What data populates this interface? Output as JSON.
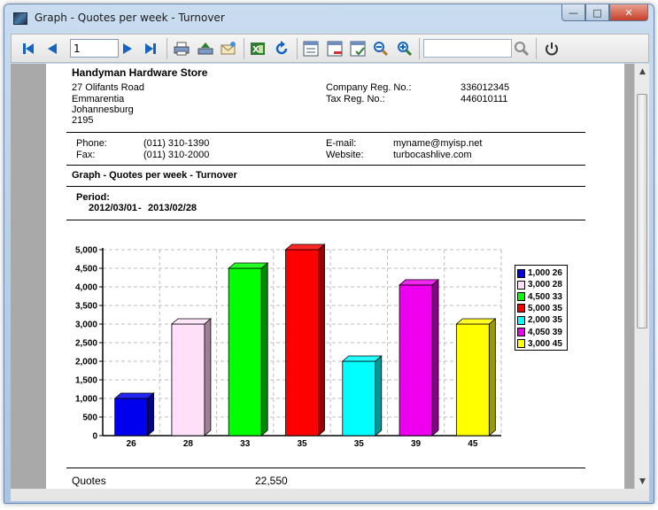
{
  "window": {
    "title": "Graph - Quotes per week - Turnover",
    "controls": {
      "minimize": "—",
      "maximize": "□",
      "close": "✕"
    }
  },
  "toolbar": {
    "page_number": "1",
    "search_value": "",
    "icons": [
      "first-page-icon",
      "previous-page-icon",
      "next-page-icon",
      "last-page-icon",
      "print-icon",
      "export-icon",
      "email-icon",
      "excel-icon",
      "refresh-icon",
      "layout-icon",
      "layout-remove-icon",
      "layout-check-icon",
      "zoom-out-icon",
      "zoom-in-icon",
      "search-icon",
      "power-icon"
    ]
  },
  "report": {
    "company": {
      "name": "Handyman Hardware Store",
      "address": [
        "27 Olifants Road",
        "Emmarentia",
        "Johannesburg",
        "2195"
      ],
      "company_reg_label": "Company Reg. No.:",
      "company_reg_value": "336012345",
      "tax_reg_label": "Tax Reg. No.:",
      "tax_reg_value": "446010111"
    },
    "contact": {
      "phone_label": "Phone:",
      "phone_value": "(011) 310-1390",
      "fax_label": "Fax:",
      "fax_value": "(011) 310-2000",
      "email_label": "E-mail:",
      "email_value": "myname@myisp.net",
      "website_label": "Website:",
      "website_value": "turbocashlive.com"
    },
    "report_title": "Graph - Quotes per week - Turnover",
    "period_label": "Period:",
    "period_from": "2012/03/01",
    "period_sep": "-",
    "period_to": "2013/02/28",
    "footer_label": "Quotes",
    "footer_total": "22,550"
  },
  "chart_data": {
    "type": "bar",
    "categories": [
      "26",
      "28",
      "33",
      "35",
      "35",
      "39",
      "45"
    ],
    "values": [
      1000,
      3000,
      4500,
      5000,
      2000,
      4050,
      3000
    ],
    "colors": [
      "#0000ee",
      "#ffe0f8",
      "#00ff00",
      "#ff0000",
      "#00ffff",
      "#ee00ee",
      "#ffff00"
    ],
    "side_colors": [
      "#000088",
      "#a08098",
      "#008800",
      "#990000",
      "#009999",
      "#880088",
      "#999900"
    ],
    "yticks": [
      "0",
      "500",
      "1,000",
      "1,500",
      "2,000",
      "2,500",
      "3,000",
      "3,500",
      "4,000",
      "4,500",
      "5,000"
    ],
    "ylim": [
      0,
      5000
    ],
    "legend": [
      "1,000 26",
      "3,000 28",
      "4,500 33",
      "5,000 35",
      "2,000 35",
      "4,050 39",
      "3,000 45"
    ],
    "legend_placement": "right",
    "grid": true
  }
}
